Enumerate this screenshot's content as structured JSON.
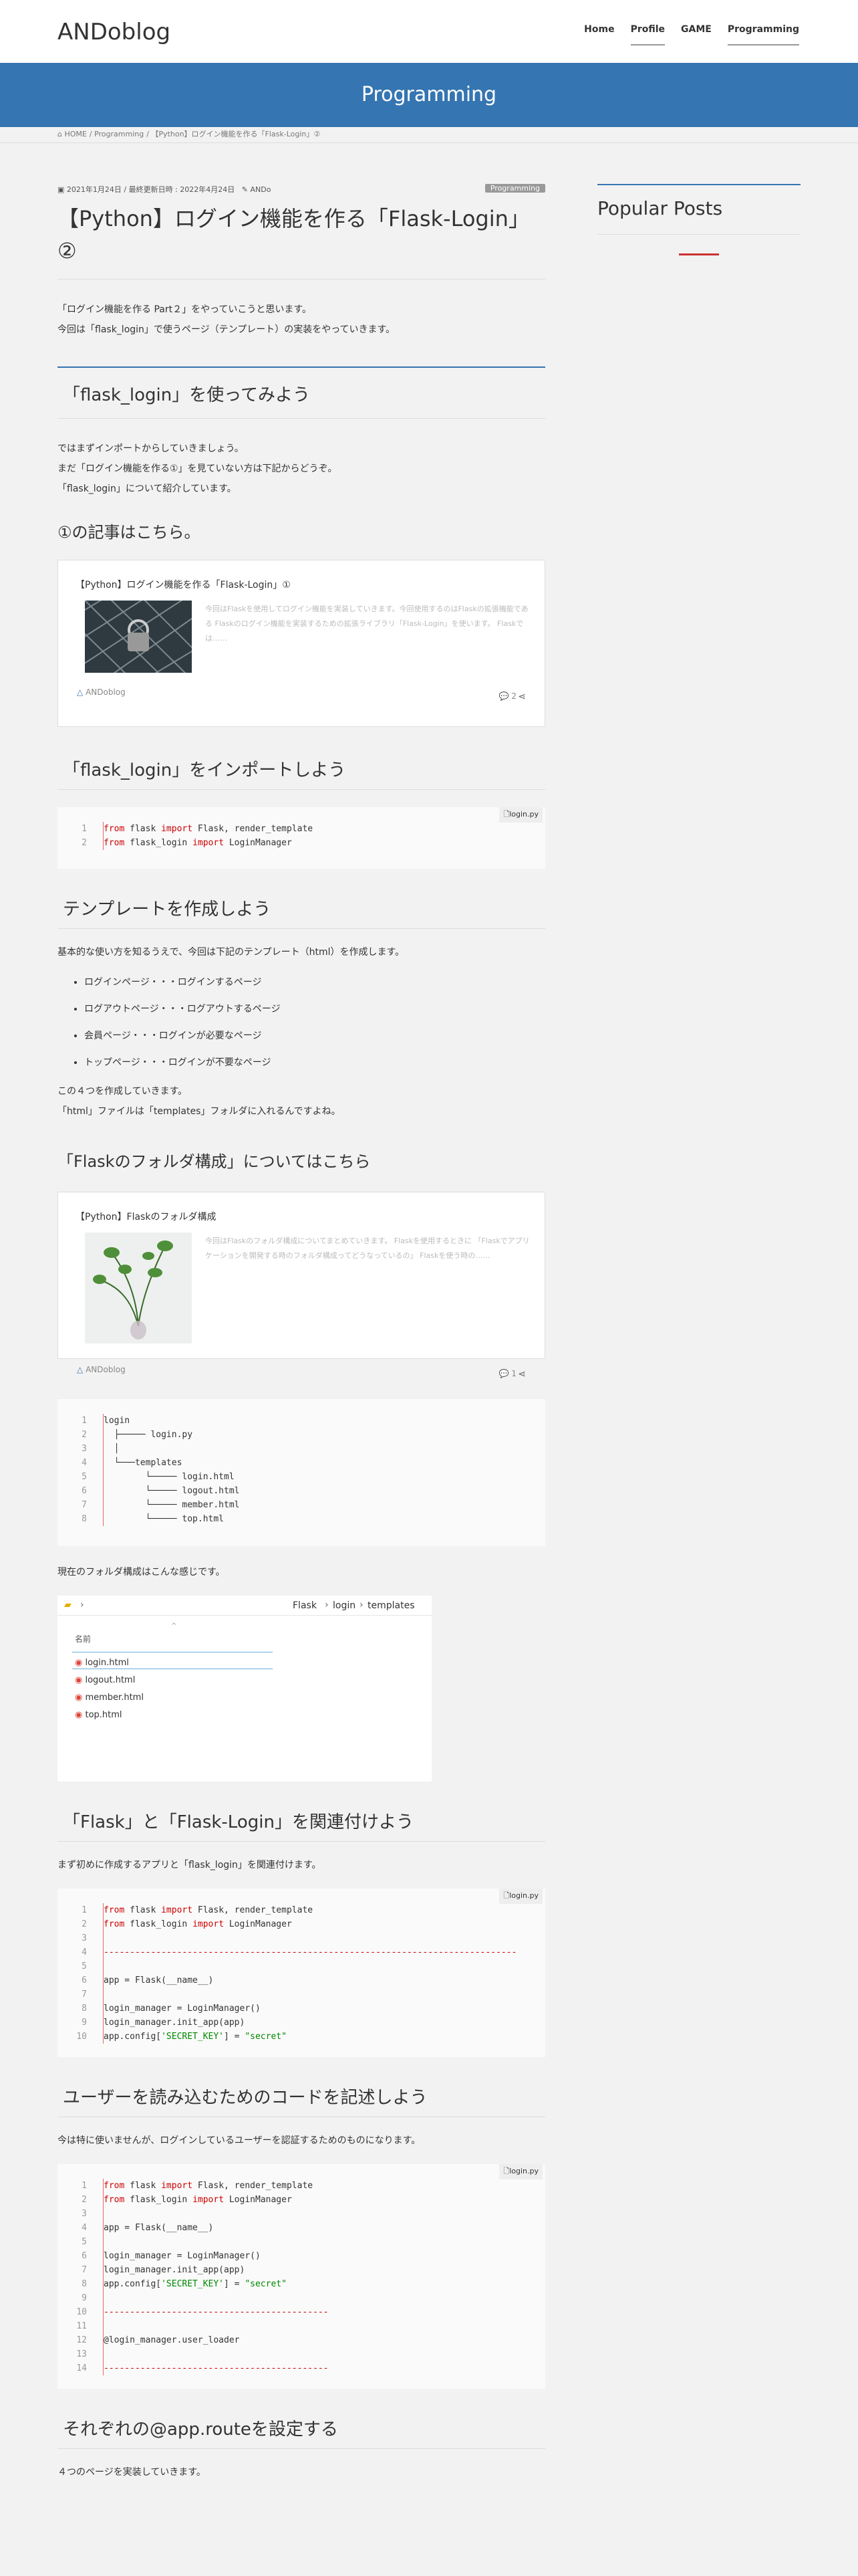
{
  "header": {
    "logo": "ANDoblog",
    "nav": [
      "Home",
      "Profile",
      "GAME",
      "Programming"
    ]
  },
  "banner": "Programming",
  "breadcrumb": [
    "⌂ HOME",
    "Programming",
    "【Python】ログイン機能を作る「Flask-Login」②"
  ],
  "post": {
    "date": "▣ 2021年1月24日 / 最終更新日時 : 2022年4月24日",
    "author": "✎ ANDo",
    "category": "Programming",
    "title": "【Python】ログイン機能を作る「Flask-Login」②",
    "intro": [
      "「ログイン機能を作る Part２」をやっていこうと思います。",
      "今回は「flask_login」で使うページ（テンプレート）の実装をやっていきます。"
    ],
    "h2_1": "「flask_login」を使ってみよう",
    "p1": [
      "ではまずインポートからしていきましょう。",
      "まだ「ログイン機能を作る①」を見ていない方は下記からどうぞ。",
      "「flask_login」について紹介しています。"
    ],
    "h3_1": "①の記事はこちら。",
    "card1": {
      "title": "【Python】ログイン機能を作る「Flask-Login」①",
      "excerpt": "今回はFlaskを使用してログイン機能を実装していきます。今回使用するのはFlaskの拡張機能である Flaskのログイン機能を実装するための拡張ライブラリ「Flask-Login」を使います。 Flaskでは……",
      "comments": "2",
      "brand": "ANDoblog"
    },
    "h2_2": "「flask_login」をインポートしよう",
    "code1": {
      "file": "🗋login.py"
    },
    "h2_3": "テンプレートを作成しよう",
    "p2": "基本的な使い方を知るうえで、今回は下記のテンプレート（html）を作成します。",
    "list": [
      "ログインページ・・・ログインするページ",
      "ログアウトページ・・・ログアウトするページ",
      "会員ページ・・・ログインが必要なページ",
      "トップページ・・・ログインが不要なページ"
    ],
    "p3": [
      "この４つを作成していきます。",
      "「html」ファイルは「templates」フォルダに入れるんですよね。"
    ],
    "h3_2": "「Flaskのフォルダ構成」についてはこちら",
    "card2": {
      "title": "【Python】Flaskのフォルダ構成",
      "excerpt": "今回はFlaskのフォルダ構成についてまとめていきます。 Flaskを使用するときに 「Flaskでアプリケーションを開発する時のフォルダ構成ってどうなっているの」 Flaskを使う時の……",
      "comments": "1",
      "brand": "ANDoblog"
    },
    "p4": "現在のフォルダ構成はこんな感じです。",
    "explorer": {
      "path": [
        "Flask",
        "login",
        "templates"
      ],
      "col": "名前",
      "files": [
        "login.html",
        "logout.html",
        "member.html",
        "top.html"
      ]
    },
    "h2_4": "「Flask」と「Flask-Login」を関連付けよう",
    "p5": "まず初めに作成するアプリと「flask_login」を関連付けます。",
    "h2_5": "ユーザーを読み込むためのコードを記述しよう",
    "p6": "今は特に使いませんが、ログインしているユーザーを認証するためのものになります。",
    "h2_6": "それぞれの@app.routeを設定する",
    "p7": "４つのページを実装していきます。"
  },
  "sidebar": {
    "title": "Popular Posts"
  }
}
